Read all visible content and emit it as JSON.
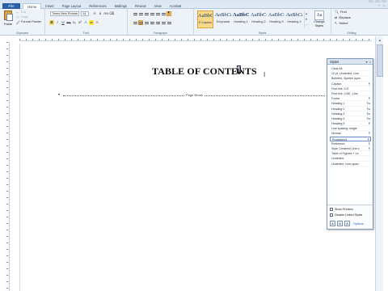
{
  "window": {
    "controls": [
      "minimize-icon",
      "maximize-icon",
      "close-icon"
    ]
  },
  "tabs": {
    "file": "File",
    "items": [
      "Home",
      "Insert",
      "Page Layout",
      "References",
      "Mailings",
      "Review",
      "View",
      "Acrobat"
    ],
    "active": "Home"
  },
  "ribbon": {
    "clipboard": {
      "paste": "Paste",
      "cut": "Cut",
      "copy": "Copy",
      "format_painter": "Format Painter",
      "label": "Clipboard"
    },
    "font": {
      "family": "Times New Roman",
      "size": "14",
      "buttons": [
        "B",
        "I",
        "U",
        "abc",
        "x₂",
        "x²",
        "A",
        "ab",
        "A"
      ],
      "label": "Font"
    },
    "paragraph": {
      "label": "Paragraph",
      "pilcrow": "¶"
    },
    "styles": {
      "label": "Styles",
      "items": [
        {
          "preview": "AaBbCcI",
          "name": "¶ Caption"
        },
        {
          "preview": "AaBbCcI",
          "name": "Emphasis"
        },
        {
          "preview": "AaBbC",
          "name": "Heading 1"
        },
        {
          "preview": "AaBbCcl",
          "name": "Heading 2"
        },
        {
          "preview": "AaBbCcI",
          "name": "Heading 3"
        },
        {
          "preview": "AaBbCcI",
          "name": "Heading 4"
        }
      ],
      "change_styles": "Change Styles",
      "change_preview": "Aa"
    },
    "editing": {
      "label": "Editing",
      "find": "Find",
      "replace": "Replace",
      "select": "Select"
    }
  },
  "document": {
    "title": "TABLE OF CONTENTS",
    "page_break": "Page Break",
    "pilcrow": "¶"
  },
  "styles_pane": {
    "title": "Styles",
    "items": [
      {
        "name": "Clear All",
        "mark": ""
      },
      {
        "name": "10 pt, Underline, Line",
        "mark": ""
      },
      {
        "name": "Bulleted, Symbol (sym",
        "mark": ""
      },
      {
        "name": "Caption",
        "mark": "¶"
      },
      {
        "name": "First line: 0.5\"",
        "mark": ""
      },
      {
        "name": "First line: 0.56\", Line",
        "mark": ""
      },
      {
        "name": "Footer",
        "mark": "¶"
      },
      {
        "name": "Heading 1",
        "mark": "¶a"
      },
      {
        "name": "Heading 2",
        "mark": "¶a"
      },
      {
        "name": "Heading 3",
        "mark": "¶a"
      },
      {
        "name": "Heading 4",
        "mark": "¶a"
      },
      {
        "name": "Heading 5",
        "mark": "¶"
      },
      {
        "name": "Line spacing: single",
        "mark": ""
      },
      {
        "name": "Normal",
        "mark": "¶"
      },
      {
        "name": "Procedure1",
        "mark": "¶"
      },
      {
        "name": "Reference",
        "mark": "¶"
      },
      {
        "name": "Style Centered Line s",
        "mark": "¶"
      },
      {
        "name": "Table of Figures + Le",
        "mark": ""
      },
      {
        "name": "Underline",
        "mark": ""
      },
      {
        "name": "Underline, Line spaci",
        "mark": ""
      }
    ],
    "selected_index": 14,
    "show_preview": "Show Preview",
    "disable_linked": "Disable Linked Styles",
    "options": "Options..."
  }
}
